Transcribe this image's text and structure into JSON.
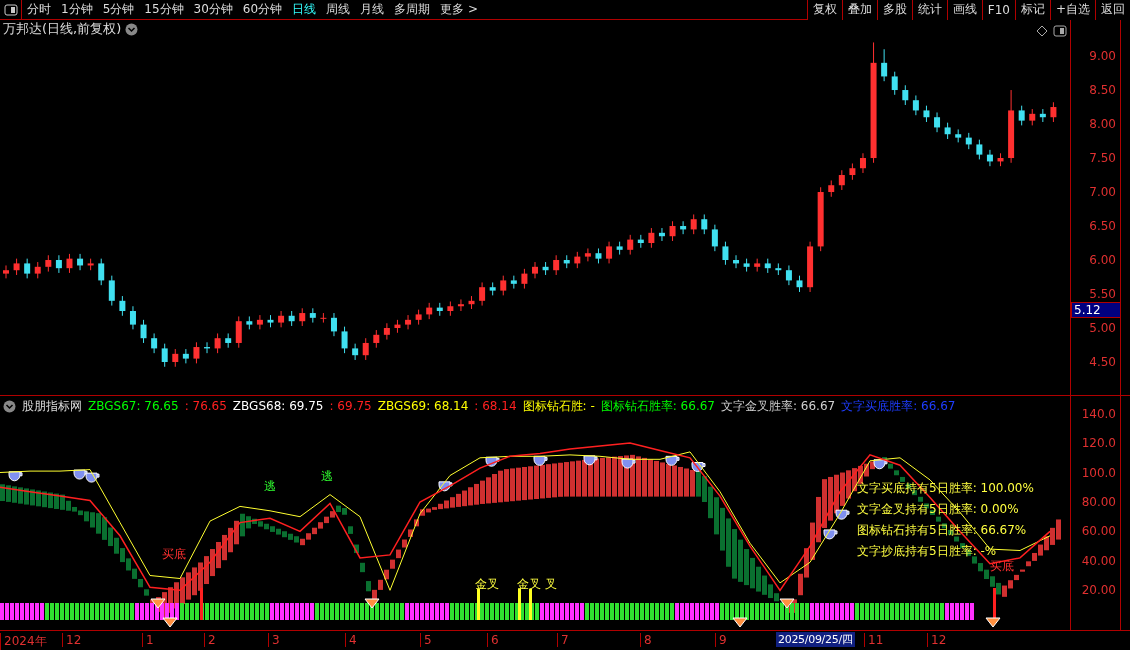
{
  "toolbar": {
    "periods": [
      {
        "label": "分时",
        "selected": false
      },
      {
        "label": "1分钟",
        "selected": false
      },
      {
        "label": "5分钟",
        "selected": false
      },
      {
        "label": "15分钟",
        "selected": false
      },
      {
        "label": "30分钟",
        "selected": false
      },
      {
        "label": "60分钟",
        "selected": false
      },
      {
        "label": "日线",
        "selected": true
      },
      {
        "label": "周线",
        "selected": false
      },
      {
        "label": "月线",
        "selected": false
      },
      {
        "label": "多周期",
        "selected": false
      }
    ],
    "more": "更多 >",
    "actions": [
      "复权",
      "叠加",
      "多股",
      "统计",
      "画线",
      "F10",
      "标记",
      "+自选",
      "返回"
    ]
  },
  "price_chart": {
    "title": "万邦达(日线,前复权)",
    "current_price": "5.12",
    "chart_data": {
      "type": "candlestick",
      "ylim": [
        4.0,
        9.53
      ],
      "yticks": [
        {
          "value": 9,
          "label": "9.00"
        },
        {
          "value": 8.5,
          "label": "8.50"
        },
        {
          "value": 8,
          "label": "8.00"
        },
        {
          "value": 7.5,
          "label": "7.50"
        },
        {
          "value": 7,
          "label": "7.00"
        },
        {
          "value": 6.5,
          "label": "6.50"
        },
        {
          "value": 6,
          "label": "6.00"
        },
        {
          "value": 5.5,
          "label": "5.50"
        },
        {
          "value": 5,
          "label": "5.00"
        },
        {
          "value": 4.5,
          "label": "4.50"
        }
      ],
      "ohlc": [
        [
          5.8,
          5.92,
          5.73,
          5.85
        ],
        [
          5.85,
          6.02,
          5.78,
          5.95
        ],
        [
          5.95,
          6.02,
          5.73,
          5.8
        ],
        [
          5.8,
          5.97,
          5.73,
          5.9
        ],
        [
          5.9,
          6.07,
          5.83,
          6.0
        ],
        [
          6.0,
          6.07,
          5.81,
          5.88
        ],
        [
          5.88,
          6.09,
          5.81,
          6.02
        ],
        [
          6.02,
          6.09,
          5.85,
          5.92
        ],
        [
          5.92,
          6.02,
          5.85,
          5.95
        ],
        [
          5.95,
          6.02,
          5.63,
          5.7
        ],
        [
          5.7,
          5.77,
          5.33,
          5.4
        ],
        [
          5.4,
          5.47,
          5.18,
          5.25
        ],
        [
          5.25,
          5.32,
          4.98,
          5.05
        ],
        [
          5.05,
          5.12,
          4.78,
          4.85
        ],
        [
          4.85,
          4.92,
          4.63,
          4.7
        ],
        [
          4.7,
          4.77,
          4.43,
          4.5
        ],
        [
          4.5,
          4.69,
          4.43,
          4.62
        ],
        [
          4.62,
          4.69,
          4.48,
          4.55
        ],
        [
          4.55,
          4.79,
          4.48,
          4.72
        ],
        [
          4.72,
          4.79,
          4.63,
          4.7
        ],
        [
          4.7,
          4.92,
          4.63,
          4.85
        ],
        [
          4.85,
          4.92,
          4.71,
          4.78
        ],
        [
          4.78,
          5.17,
          4.71,
          5.1
        ],
        [
          5.1,
          5.17,
          4.98,
          5.05
        ],
        [
          5.05,
          5.19,
          4.98,
          5.12
        ],
        [
          5.12,
          5.19,
          5.01,
          5.08
        ],
        [
          5.08,
          5.25,
          5.01,
          5.18
        ],
        [
          5.18,
          5.25,
          5.03,
          5.1
        ],
        [
          5.1,
          5.29,
          5.03,
          5.22
        ],
        [
          5.22,
          5.29,
          5.08,
          5.15
        ],
        [
          5.15,
          5.22,
          5.08,
          5.15
        ],
        [
          5.15,
          5.22,
          4.88,
          4.95
        ],
        [
          4.95,
          5.02,
          4.63,
          4.7
        ],
        [
          4.7,
          4.77,
          4.53,
          4.6
        ],
        [
          4.6,
          4.85,
          4.53,
          4.78
        ],
        [
          4.78,
          4.97,
          4.71,
          4.9
        ],
        [
          4.9,
          5.07,
          4.83,
          5.0
        ],
        [
          5.0,
          5.12,
          4.93,
          5.05
        ],
        [
          5.05,
          5.19,
          4.98,
          5.12
        ],
        [
          5.12,
          5.27,
          5.05,
          5.2
        ],
        [
          5.2,
          5.37,
          5.13,
          5.3
        ],
        [
          5.3,
          5.37,
          5.18,
          5.25
        ],
        [
          5.25,
          5.39,
          5.18,
          5.32
        ],
        [
          5.32,
          5.42,
          5.25,
          5.35
        ],
        [
          5.35,
          5.47,
          5.28,
          5.4
        ],
        [
          5.4,
          5.67,
          5.33,
          5.6
        ],
        [
          5.6,
          5.67,
          5.48,
          5.55
        ],
        [
          5.55,
          5.77,
          5.48,
          5.7
        ],
        [
          5.7,
          5.77,
          5.58,
          5.65
        ],
        [
          5.65,
          5.87,
          5.58,
          5.8
        ],
        [
          5.8,
          5.97,
          5.73,
          5.9
        ],
        [
          5.9,
          5.97,
          5.78,
          5.85
        ],
        [
          5.85,
          6.07,
          5.78,
          6.0
        ],
        [
          6.0,
          6.07,
          5.88,
          5.95
        ],
        [
          5.95,
          6.12,
          5.88,
          6.05
        ],
        [
          6.05,
          6.17,
          5.98,
          6.1
        ],
        [
          6.1,
          6.17,
          5.95,
          6.02
        ],
        [
          6.02,
          6.27,
          5.95,
          6.2
        ],
        [
          6.2,
          6.27,
          6.08,
          6.15
        ],
        [
          6.15,
          6.37,
          6.08,
          6.3
        ],
        [
          6.3,
          6.37,
          6.18,
          6.25
        ],
        [
          6.25,
          6.47,
          6.18,
          6.4
        ],
        [
          6.4,
          6.47,
          6.28,
          6.35
        ],
        [
          6.35,
          6.57,
          6.28,
          6.5
        ],
        [
          6.5,
          6.57,
          6.38,
          6.45
        ],
        [
          6.45,
          6.67,
          6.38,
          6.6
        ],
        [
          6.6,
          6.67,
          6.38,
          6.45
        ],
        [
          6.45,
          6.52,
          6.13,
          6.2
        ],
        [
          6.2,
          6.27,
          5.93,
          6.0
        ],
        [
          6.0,
          6.07,
          5.88,
          5.95
        ],
        [
          5.95,
          6.02,
          5.83,
          5.9
        ],
        [
          5.9,
          6.02,
          5.83,
          5.95
        ],
        [
          5.95,
          6.02,
          5.81,
          5.88
        ],
        [
          5.88,
          5.95,
          5.78,
          5.85
        ],
        [
          5.85,
          5.92,
          5.63,
          5.7
        ],
        [
          5.7,
          5.77,
          5.53,
          5.6
        ],
        [
          5.6,
          6.27,
          5.53,
          6.2
        ],
        [
          6.2,
          7.07,
          6.13,
          7.0
        ],
        [
          7.0,
          7.17,
          6.93,
          7.1
        ],
        [
          7.1,
          7.32,
          7.03,
          7.25
        ],
        [
          7.25,
          7.42,
          7.18,
          7.35
        ],
        [
          7.35,
          7.57,
          7.28,
          7.5
        ],
        [
          7.5,
          9.2,
          7.43,
          8.9
        ],
        [
          8.9,
          9.1,
          8.63,
          8.7
        ],
        [
          8.7,
          8.77,
          8.43,
          8.5
        ],
        [
          8.5,
          8.57,
          8.28,
          8.35
        ],
        [
          8.35,
          8.42,
          8.13,
          8.2
        ],
        [
          8.2,
          8.27,
          8.03,
          8.1
        ],
        [
          8.1,
          8.17,
          7.88,
          7.95
        ],
        [
          7.95,
          8.02,
          7.78,
          7.85
        ],
        [
          7.85,
          7.92,
          7.73,
          7.8
        ],
        [
          7.8,
          7.87,
          7.63,
          7.7
        ],
        [
          7.7,
          7.77,
          7.48,
          7.55
        ],
        [
          7.55,
          7.62,
          7.38,
          7.45
        ],
        [
          7.45,
          7.57,
          7.38,
          7.5
        ],
        [
          7.5,
          8.5,
          7.43,
          8.2
        ],
        [
          8.2,
          8.27,
          7.98,
          8.05
        ],
        [
          8.05,
          8.22,
          7.98,
          8.15
        ],
        [
          8.15,
          8.22,
          8.03,
          8.1
        ],
        [
          8.1,
          8.32,
          8.03,
          8.25
        ]
      ]
    }
  },
  "indicator": {
    "name": "股朋指标网",
    "legend": [
      {
        "text": "ZBGS67: 76.65",
        "color": "#00ff00"
      },
      {
        "text": ": 76.65",
        "color": "#ff2020"
      },
      {
        "text": "ZBGS68: 69.75",
        "color": "#ffffff"
      },
      {
        "text": ": 69.75",
        "color": "#ff2020"
      },
      {
        "text": "ZBGS69: 68.14",
        "color": "#ffff00"
      },
      {
        "text": ": 68.14",
        "color": "#ff2020"
      },
      {
        "text": "图标钻石胜: -",
        "color": "#ffff00"
      },
      {
        "text": "图标钻石胜率: 66.67",
        "color": "#00ff00"
      },
      {
        "text": "文字金叉胜率: 66.67",
        "color": "#d0d0d0"
      },
      {
        "text": "文字买底胜率: 66.67",
        "color": "#1e3cff"
      }
    ],
    "signals": [
      {
        "kind": "escape",
        "label": "逃"
      },
      {
        "kind": "escape",
        "label": "逃"
      },
      {
        "kind": "buy",
        "label": "买底"
      },
      {
        "kind": "cross",
        "label": "金叉"
      },
      {
        "kind": "cross",
        "label": "金叉"
      },
      {
        "kind": "cross",
        "label": "叉"
      },
      {
        "kind": "buy",
        "label": "买底"
      }
    ],
    "stats": [
      "文字买底持有5日胜率: 100.00%",
      "文字金叉持有5日胜率: 0.00%",
      "图标钻石持有5日胜率: 66.67%",
      "文字抄底持有5日胜率: -%"
    ],
    "chart_data": {
      "type": "line",
      "ylim": [
        -7,
        152
      ],
      "yticks": [
        {
          "value": 140,
          "label": "140.0"
        },
        {
          "value": 120,
          "label": "120.0"
        },
        {
          "value": 100,
          "label": "100.0"
        },
        {
          "value": 80,
          "label": "80.00"
        },
        {
          "value": 60,
          "label": "60.00"
        },
        {
          "value": 40,
          "label": "40.00"
        },
        {
          "value": 20,
          "label": "20.00"
        }
      ],
      "series": [
        {
          "color": "#ffff30",
          "values": [
            100,
            101,
            101,
            102,
            66,
            30,
            28,
            67,
            77,
            74,
            70,
            85,
            70,
            20,
            72,
            98,
            110,
            111,
            111,
            112,
            111,
            109,
            109,
            114,
            87,
            52,
            25,
            39,
            72,
            108,
            110,
            95,
            73,
            48,
            47,
            57
          ]
        },
        {
          "color": "#ff2020",
          "values": [
            90,
            87,
            84,
            81,
            57,
            22,
            20,
            39,
            66,
            69,
            60,
            79,
            42,
            44,
            80,
            91,
            103,
            111,
            113,
            116,
            118,
            120,
            115,
            110,
            84,
            50,
            20,
            50,
            87,
            112,
            105,
            83,
            60,
            38,
            42,
            60
          ]
        }
      ]
    }
  },
  "time_axis": {
    "labels": [
      "2024年",
      "12",
      "1",
      "2",
      "3",
      "4",
      "5",
      "6",
      "7",
      "8",
      "9",
      "11",
      "12"
    ],
    "cursor_date": "2025/09/25/四"
  }
}
